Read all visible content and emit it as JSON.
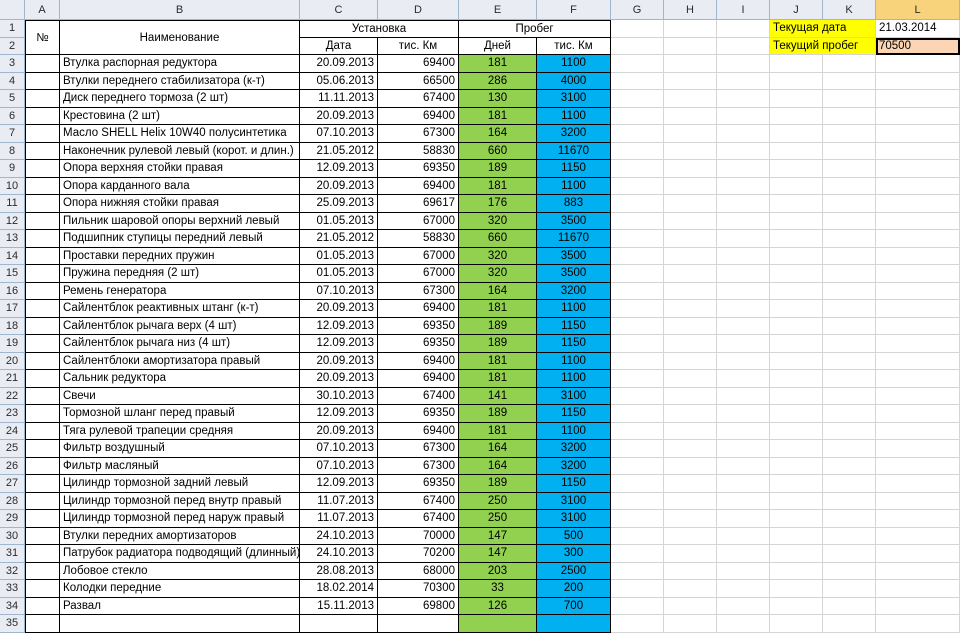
{
  "columns": [
    "A",
    "B",
    "C",
    "D",
    "E",
    "F",
    "G",
    "H",
    "I",
    "J",
    "K",
    "L"
  ],
  "selected_column": "L",
  "header": {
    "no": "№",
    "name": "Наименование",
    "install": "Установка",
    "mileage": "Пробег",
    "date": "Дата",
    "km_thousand": "тис. Км",
    "days": "Дней",
    "km_thousand2": "тис. Км"
  },
  "info": {
    "current_date_label": "Текущая дата",
    "current_date_value": "21.03.2014",
    "current_mileage_label": "Текущий пробег",
    "current_mileage_value": "70500"
  },
  "rows": [
    {
      "name": "Втулка распорная редуктора",
      "date": "20.09.2013",
      "km": "69400",
      "days": "181",
      "since": "1100"
    },
    {
      "name": "Втулки переднего стабилизатора (к-т)",
      "date": "05.06.2013",
      "km": "66500",
      "days": "286",
      "since": "4000"
    },
    {
      "name": "Диск переднего тормоза (2 шт)",
      "date": "11.11.2013",
      "km": "67400",
      "days": "130",
      "since": "3100"
    },
    {
      "name": "Крестовина (2 шт)",
      "date": "20.09.2013",
      "km": "69400",
      "days": "181",
      "since": "1100"
    },
    {
      "name": "Масло SHELL Helix 10W40 полусинтетика",
      "date": "07.10.2013",
      "km": "67300",
      "days": "164",
      "since": "3200"
    },
    {
      "name": "Наконечник рулевой левый (корот. и длин.)",
      "date": "21.05.2012",
      "km": "58830",
      "days": "660",
      "since": "11670"
    },
    {
      "name": "Опора верхняя стойки правая",
      "date": "12.09.2013",
      "km": "69350",
      "days": "189",
      "since": "1150"
    },
    {
      "name": "Опора карданного вала",
      "date": "20.09.2013",
      "km": "69400",
      "days": "181",
      "since": "1100"
    },
    {
      "name": "Опора нижняя стойки правая",
      "date": "25.09.2013",
      "km": "69617",
      "days": "176",
      "since": "883"
    },
    {
      "name": "Пильник шаровой опоры верхний левый",
      "date": "01.05.2013",
      "km": "67000",
      "days": "320",
      "since": "3500"
    },
    {
      "name": "Подшипник ступицы передний левый",
      "date": "21.05.2012",
      "km": "58830",
      "days": "660",
      "since": "11670"
    },
    {
      "name": "Проставки передних пружин",
      "date": "01.05.2013",
      "km": "67000",
      "days": "320",
      "since": "3500"
    },
    {
      "name": "Пружина передняя (2 шт)",
      "date": "01.05.2013",
      "km": "67000",
      "days": "320",
      "since": "3500"
    },
    {
      "name": "Ремень генератора",
      "date": "07.10.2013",
      "km": "67300",
      "days": "164",
      "since": "3200"
    },
    {
      "name": "Сайлентблок  реактивных штанг (к-т)",
      "date": "20.09.2013",
      "km": "69400",
      "days": "181",
      "since": "1100"
    },
    {
      "name": "Сайлентблок рычага верх (4 шт)",
      "date": "12.09.2013",
      "km": "69350",
      "days": "189",
      "since": "1150"
    },
    {
      "name": "Сайлентблок рычага низ (4 шт)",
      "date": "12.09.2013",
      "km": "69350",
      "days": "189",
      "since": "1150"
    },
    {
      "name": "Сайлентблоки амортизатора правый",
      "date": "20.09.2013",
      "km": "69400",
      "days": "181",
      "since": "1100"
    },
    {
      "name": "Сальник редуктора",
      "date": "20.09.2013",
      "km": "69400",
      "days": "181",
      "since": "1100"
    },
    {
      "name": "Свечи",
      "date": "30.10.2013",
      "km": "67400",
      "days": "141",
      "since": "3100"
    },
    {
      "name": "Тормозной шланг перед правый",
      "date": "12.09.2013",
      "km": "69350",
      "days": "189",
      "since": "1150"
    },
    {
      "name": "Тяга рулевой трапеции средняя",
      "date": "20.09.2013",
      "km": "69400",
      "days": "181",
      "since": "1100"
    },
    {
      "name": "Фильтр воздушный",
      "date": "07.10.2013",
      "km": "67300",
      "days": "164",
      "since": "3200"
    },
    {
      "name": "Фильтр масляный",
      "date": "07.10.2013",
      "km": "67300",
      "days": "164",
      "since": "3200"
    },
    {
      "name": "Цилиндр тормозной задний левый",
      "date": "12.09.2013",
      "km": "69350",
      "days": "189",
      "since": "1150"
    },
    {
      "name": "Цилиндр тормозной перед  внутр правый",
      "date": "11.07.2013",
      "km": "67400",
      "days": "250",
      "since": "3100"
    },
    {
      "name": "Цилиндр тормозной перед  наруж правый",
      "date": "11.07.2013",
      "km": "67400",
      "days": "250",
      "since": "3100"
    },
    {
      "name": "Втулки передних амортизаторов",
      "date": "24.10.2013",
      "km": "70000",
      "days": "147",
      "since": "500"
    },
    {
      "name": "Патрубок радиатора подводящий (длинный)",
      "date": "24.10.2013",
      "km": "70200",
      "days": "147",
      "since": "300"
    },
    {
      "name": "Лобовое стекло",
      "date": "28.08.2013",
      "km": "68000",
      "days": "203",
      "since": "2500"
    },
    {
      "name": "Колодки передние",
      "date": "18.02.2014",
      "km": "70300",
      "days": "33",
      "since": "200"
    },
    {
      "name": "Развал",
      "date": "15.11.2013",
      "km": "69800",
      "days": "126",
      "since": "700"
    },
    {
      "name": "",
      "date": "",
      "km": "",
      "days": "",
      "since": ""
    }
  ],
  "colors": {
    "days_fill": "#92d050",
    "km_fill": "#00b0f0",
    "label_fill": "#ffff00",
    "input_fill": "#fcd5b4",
    "header_bg": "#e9edf3",
    "selected_header": "#f8d37b"
  }
}
